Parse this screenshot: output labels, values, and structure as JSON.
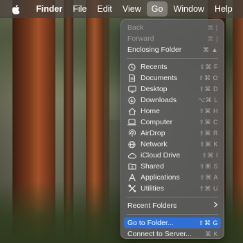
{
  "menubar": {
    "apple_icon": "apple-icon",
    "items": [
      "Finder",
      "File",
      "Edit",
      "View",
      "Go",
      "Window",
      "Help"
    ],
    "active": "Go"
  },
  "go_menu": {
    "nav": [
      {
        "label": "Back",
        "shortcut": "⌘ [",
        "enabled": false
      },
      {
        "label": "Forward",
        "shortcut": "⌘ ]",
        "enabled": false
      },
      {
        "label": "Enclosing Folder",
        "shortcut": "⌘ ▲",
        "enabled": true
      }
    ],
    "places": [
      {
        "label": "Recents",
        "shortcut": "⇧⌘ F",
        "icon": "clock-icon"
      },
      {
        "label": "Documents",
        "shortcut": "⇧⌘ O",
        "icon": "document-icon"
      },
      {
        "label": "Desktop",
        "shortcut": "⇧⌘ D",
        "icon": "desktop-icon"
      },
      {
        "label": "Downloads",
        "shortcut": "⌥⌘ L",
        "icon": "download-icon"
      },
      {
        "label": "Home",
        "shortcut": "⇧⌘ H",
        "icon": "home-icon"
      },
      {
        "label": "Computer",
        "shortcut": "⇧⌘ C",
        "icon": "laptop-icon"
      },
      {
        "label": "AirDrop",
        "shortcut": "⇧⌘ R",
        "icon": "airdrop-icon"
      },
      {
        "label": "Network",
        "shortcut": "⇧⌘ K",
        "icon": "globe-icon"
      },
      {
        "label": "iCloud Drive",
        "shortcut": "⇧⌘ I",
        "icon": "cloud-icon"
      },
      {
        "label": "Shared",
        "shortcut": "⇧⌘ S",
        "icon": "shared-folder-icon"
      },
      {
        "label": "Applications",
        "shortcut": "⇧⌘ A",
        "icon": "applications-icon"
      },
      {
        "label": "Utilities",
        "shortcut": "⇧⌘ U",
        "icon": "utilities-icon"
      }
    ],
    "recent_folders": {
      "label": "Recent Folders",
      "icon": "chevron-right-icon"
    },
    "go_to_folder": {
      "label": "Go to Folder...",
      "shortcut": "⇧⌘ G"
    },
    "connect_to_server": {
      "label": "Connect to Server...",
      "shortcut": "⌘ K"
    }
  },
  "colors": {
    "highlight": "#2f6fd6",
    "menu_bg": "#5c5c5c"
  }
}
